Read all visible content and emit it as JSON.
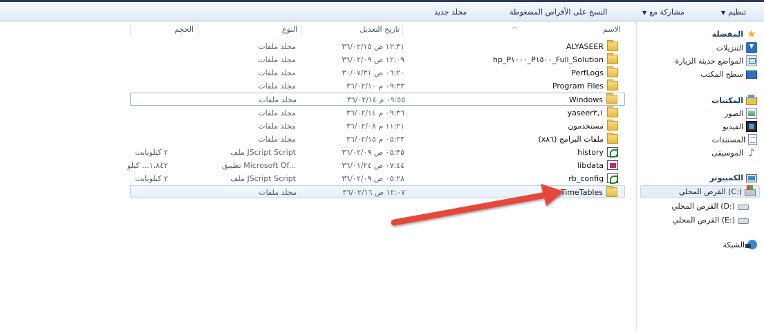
{
  "toolbar": {
    "organize": "تنظيم",
    "share_with": "مشاركة مع",
    "burn": "النسخ على الأقراص المضغوطة",
    "new_folder": "مجلد جديد"
  },
  "columns": {
    "name": "الاسم",
    "date": "تاريخ التعديل",
    "type": "النوع",
    "size": "الحجم"
  },
  "files": [
    {
      "name": "ALYASEER",
      "date": "١٢:٣١ ص ٣٦/٠٢/١٥",
      "type": "مجلد ملفات",
      "size": "",
      "icon": "folder-icon"
    },
    {
      "name": "hp_P١٠٠٠_P١٥٠٠_Full_Solution",
      "date": "١٢:٠٩ ص ٣٦/٠٢/٠٩",
      "type": "مجلد ملفات",
      "size": "",
      "icon": "folder-icon"
    },
    {
      "name": "PerfLogs",
      "date": "٠٦:٢٠ ص ٣٠/٠٧/٣١",
      "type": "مجلد ملفات",
      "size": "",
      "icon": "folder-icon"
    },
    {
      "name": "Program Files",
      "date": "٠٩:٣٣ م ٣٦/٠٢/١٠",
      "type": "مجلد ملفات",
      "size": "",
      "icon": "folder-icon"
    },
    {
      "name": "Windows",
      "date": "٠٩:٥٥ م ٣٦/٠٢/١٤",
      "type": "مجلد ملفات",
      "size": "",
      "icon": "folder-icon"
    },
    {
      "name": "yaseer٣,١",
      "date": "٠٩:٣٦ م ٣٦/٠٢/١٤",
      "type": "مجلد ملفات",
      "size": "",
      "icon": "folder-icon"
    },
    {
      "name": "مستخدمون",
      "date": "١١:٢١ م ٣٦/٠٢/٠٨",
      "type": "مجلد ملفات",
      "size": "",
      "icon": "folder-icon"
    },
    {
      "name": "ملفات البرامج (x٨٦)",
      "date": "٠٥:٢٣ م ٣٦/٠٢/١٥",
      "type": "مجلد ملفات",
      "size": "",
      "icon": "folder-icon"
    },
    {
      "name": "history",
      "date": "٠٥:٣٥ ص ٣٦/٠٢/٠٩",
      "type": "ملف JScript Script",
      "size": "٢ كيلوبايت",
      "icon": "script-file-icon"
    },
    {
      "name": "libdata",
      "date": "٠٧:٤٤ ص ٣٦/٠١/٢٤",
      "type": "تطبيق Microsoft Of...",
      "size": "١،٨٤٢... كيلو",
      "icon": "access-file-icon"
    },
    {
      "name": "rb_config",
      "date": "٠٥:٢٨ ص ٣٦/٠٢/٠٩",
      "type": "ملف JScript Script",
      "size": "٢ كيلوبايت",
      "icon": "script-file-icon"
    },
    {
      "name": "TimeTables",
      "date": "١٢:٠٧ ص ٣٦/٠٢/١٦",
      "type": "مجلد ملفات",
      "size": "",
      "icon": "folder-icon"
    }
  ],
  "nav": {
    "favorites": "المفضلة",
    "downloads": "التنزيلات",
    "recent": "المواضع حديثة الزيارة",
    "desktop": "سطح المكتب",
    "libraries": "المكتبات",
    "pictures": "الصور",
    "videos": "الفيديو",
    "documents": "المستندات",
    "music": "الموسيقى",
    "computer": "الكمبيوتر",
    "drive_c": "القرص المحلي (C:)",
    "drive_d": "القرص المحلي (D:)",
    "drive_e": "القرص المحلي (E:)",
    "network": "الشبكة"
  },
  "annotation_color": "#e5463a"
}
